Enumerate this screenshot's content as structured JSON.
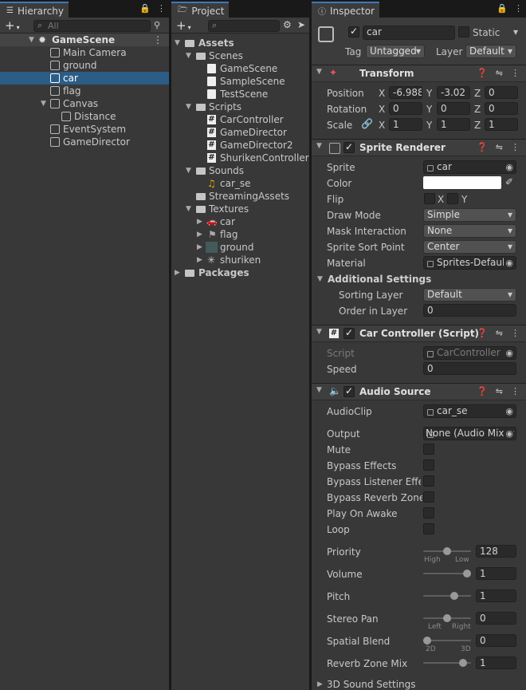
{
  "hierarchy": {
    "tab": "Hierarchy",
    "search_placeholder": "All",
    "scene": "GameScene",
    "items": [
      "Main Camera",
      "ground",
      "car",
      "flag",
      "Canvas",
      "Distance",
      "EventSystem",
      "GameDirector"
    ]
  },
  "project": {
    "tab": "Project",
    "assets": "Assets",
    "scenes": "Scenes",
    "scene_items": [
      "GameScene",
      "SampleScene",
      "TestScene"
    ],
    "scripts": "Scripts",
    "script_items": [
      "CarController",
      "GameDirector",
      "GameDirector2",
      "ShurikenController"
    ],
    "sounds": "Sounds",
    "sound_items": [
      "car_se"
    ],
    "streaming": "StreamingAssets",
    "textures": "Textures",
    "texture_items": [
      "car",
      "flag",
      "ground",
      "shuriken"
    ],
    "packages": "Packages"
  },
  "inspector": {
    "tab": "Inspector",
    "object_name": "car",
    "static_label": "Static",
    "tag_label": "Tag",
    "tag_value": "Untagged",
    "layer_label": "Layer",
    "layer_value": "Default",
    "transform": {
      "title": "Transform",
      "position_label": "Position",
      "rotation_label": "Rotation",
      "scale_label": "Scale",
      "position": [
        "-6.988",
        "-3.02",
        "0"
      ],
      "rotation": [
        "0",
        "0",
        "0"
      ],
      "scale": [
        "1",
        "1",
        "1"
      ],
      "axes": [
        "X",
        "Y",
        "Z"
      ]
    },
    "sprite_renderer": {
      "title": "Sprite Renderer",
      "sprite_label": "Sprite",
      "sprite_value": "car",
      "color_label": "Color",
      "flip_label": "Flip",
      "flip_x": "X",
      "flip_y": "Y",
      "draw_mode_label": "Draw Mode",
      "draw_mode": "Simple",
      "mask_label": "Mask Interaction",
      "mask": "None",
      "sort_point_label": "Sprite Sort Point",
      "sort_point": "Center",
      "material_label": "Material",
      "material": "Sprites-Default",
      "additional": "Additional Settings",
      "sorting_layer_label": "Sorting Layer",
      "sorting_layer": "Default",
      "order_label": "Order in Layer",
      "order": "0"
    },
    "car_controller": {
      "title": "Car Controller (Script)",
      "script_label": "Script",
      "script": "CarController",
      "speed_label": "Speed",
      "speed": "0"
    },
    "audio_source": {
      "title": "Audio Source",
      "clip_label": "AudioClip",
      "clip": "car_se",
      "output_label": "Output",
      "output": "None (Audio Mixer Group)",
      "mute_label": "Mute",
      "bypass_effects_label": "Bypass Effects",
      "bypass_listener_label": "Bypass Listener Effects",
      "bypass_reverb_label": "Bypass Reverb Zones",
      "play_label": "Play On Awake",
      "loop_label": "Loop",
      "priority_label": "Priority",
      "priority": "128",
      "priority_level": 0.5,
      "high": "High",
      "low": "Low",
      "volume_label": "Volume",
      "volume": "1",
      "volume_level": 1.0,
      "pitch_label": "Pitch",
      "pitch": "1",
      "pitch_level": 0.67,
      "stereo_label": "Stereo Pan",
      "stereo": "0",
      "stereo_level": 0.5,
      "left": "Left",
      "right": "Right",
      "spatial_label": "Spatial Blend",
      "spatial": "0",
      "spatial_level": 0.0,
      "two_d": "2D",
      "three_d": "3D",
      "reverb_label": "Reverb Zone Mix",
      "reverb": "1",
      "reverb_level": 0.9,
      "sound3d_label": "3D Sound Settings"
    }
  },
  "colors": {
    "selection": "#2c5d87",
    "accent": "#3a79bb",
    "panel": "#383838"
  }
}
